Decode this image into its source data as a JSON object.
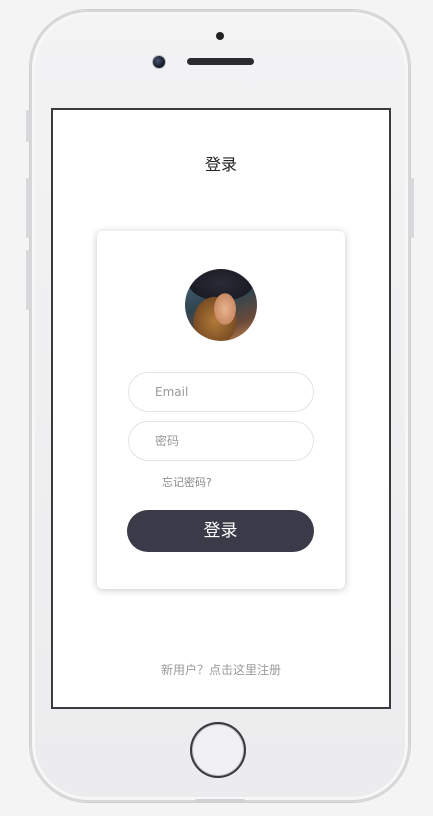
{
  "header": {
    "title": "登录"
  },
  "form": {
    "email_placeholder": "Email",
    "password_placeholder": "密码",
    "forgot_password": "忘记密码?",
    "login_button": "登录"
  },
  "footer": {
    "register_link": "新用户？点击这里注册"
  },
  "colors": {
    "button_bg": "#393b48",
    "screen_bg": "#ffffff",
    "device_body": "#ececee"
  }
}
